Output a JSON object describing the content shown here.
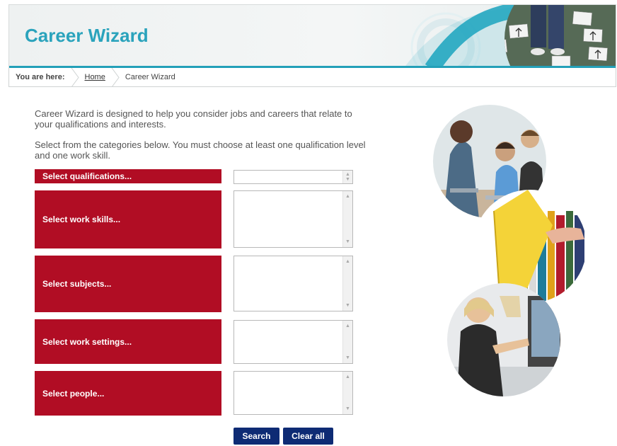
{
  "header": {
    "title": "Career Wizard"
  },
  "breadcrumb": {
    "here_label": "You are here:",
    "home": "Home",
    "current": "Career Wizard"
  },
  "intro": {
    "paragraph1": "Career Wizard is designed to help you consider jobs and careers that relate to your qualifications and interests.",
    "paragraph2": "Select from the categories below. You must choose at least one qualification level and one work skill."
  },
  "categories": [
    {
      "label": "Select qualifications..."
    },
    {
      "label": "Select work skills..."
    },
    {
      "label": "Select subjects..."
    },
    {
      "label": "Select work settings..."
    },
    {
      "label": "Select people..."
    }
  ],
  "buttons": {
    "search": "Search",
    "clear_all": "Clear all"
  },
  "colors": {
    "accent": "#2aa3bc",
    "category_bg": "#b10d24",
    "button_bg": "#0e2b74"
  },
  "icons": {
    "scroll_up": "▲",
    "scroll_down": "▼",
    "breadcrumb_separator": "chevron-right-icon"
  }
}
